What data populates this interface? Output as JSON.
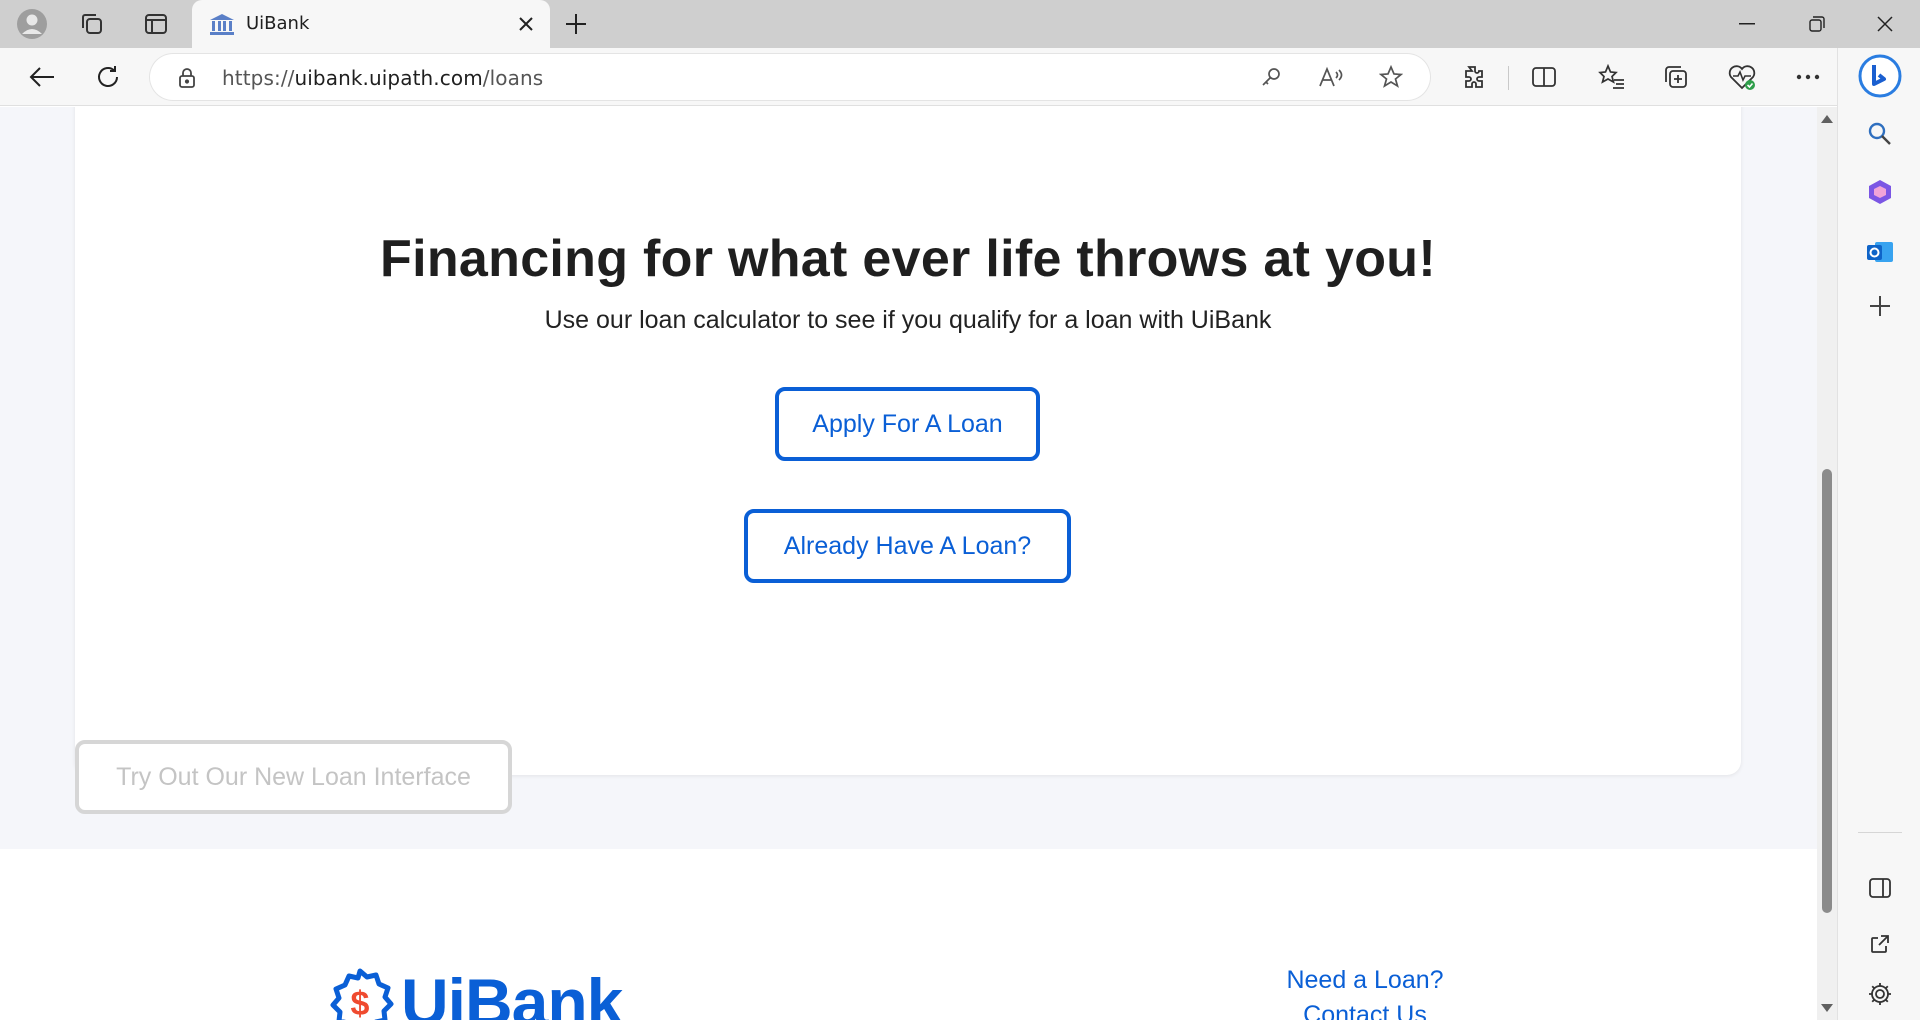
{
  "browser": {
    "tab_title": "UiBank",
    "url_prefix": "https://",
    "url_host": "uibank.uipath.com",
    "url_path": "/loans"
  },
  "page": {
    "headline": "Financing for what ever life throws at you!",
    "subline": "Use our loan calculator to see if you qualify for a loan with UiBank",
    "apply_button": "Apply For A Loan",
    "already_button": "Already Have A Loan?",
    "try_button": "Try Out Our New Loan Interface"
  },
  "footer": {
    "logo_text": "UiBank",
    "links": [
      "Need a Loan?",
      "Contact Us"
    ]
  },
  "colors": {
    "accent": "#0a5fd6",
    "page_bg": "#f5f6fa",
    "disabled": "#c4c4c4"
  }
}
